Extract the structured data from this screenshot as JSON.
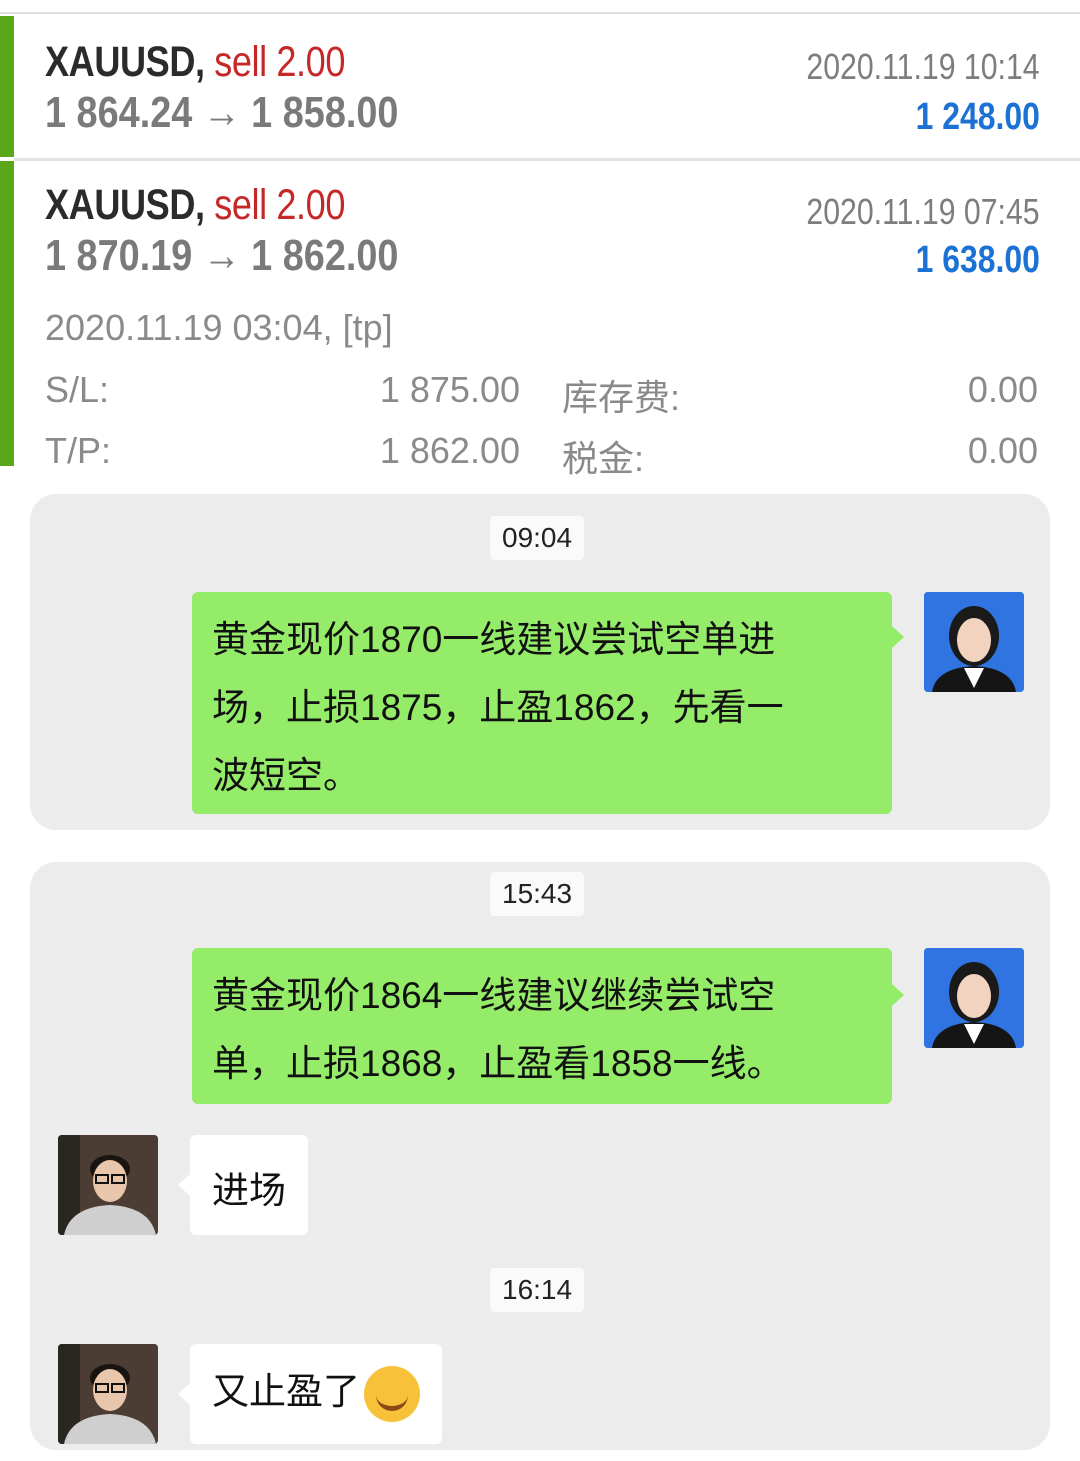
{
  "trades": [
    {
      "symbol": "XAUUSD,",
      "action": "sell 2.00",
      "open_price": "1 864.24",
      "arrow": "→",
      "close_price": "1 858.00",
      "close_time": "2020.11.19 10:14",
      "profit": "1 248.00"
    },
    {
      "symbol": "XAUUSD,",
      "action": "sell 2.00",
      "open_price": "1 870.19",
      "arrow": "→",
      "close_price": "1 862.00",
      "close_time": "2020.11.19 07:45",
      "profit": "1 638.00",
      "open_time": "2020.11.19 03:04, [tp]",
      "sl_label": "S/L:",
      "sl_value": "1 875.00",
      "tp_label": "T/P:",
      "tp_value": "1 862.00",
      "swap_label": "库存费:",
      "swap_value": "0.00",
      "tax_label": "税金:",
      "tax_value": "0.00"
    }
  ],
  "chat1": {
    "timestamp": "09:04",
    "message_lines": [
      "黄金现价1870一线建议尝试空单进",
      "场，止损1875，止盈1862，先看一",
      "波短空。"
    ]
  },
  "chat2": {
    "timestamp1": "15:43",
    "message_lines": [
      "黄金现价1864一线建议继续尝试空",
      "单，止损1868，止盈看1858一线。"
    ],
    "reply1": "进场",
    "timestamp2": "16:14",
    "reply2": "又止盈了"
  },
  "colors": {
    "accent_bar": "#5aa81a",
    "sell_red": "#c62828",
    "profit_blue": "#1c72d4",
    "bubble_green": "#95ec69"
  },
  "icons": {
    "advisor_avatar": "advisor-avatar",
    "client_avatar": "client-avatar",
    "emoji": "grinning-hands-emoji"
  }
}
